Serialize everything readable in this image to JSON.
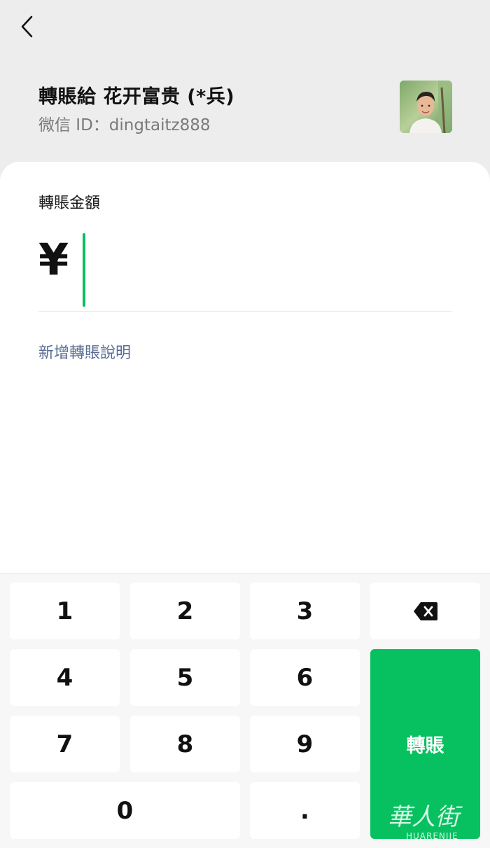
{
  "header": {
    "title": "轉賬給 花开富贵 (*兵)",
    "wechat_id": "微信 ID：dingtaitz888"
  },
  "amount": {
    "label": "轉賬金額",
    "currency": "¥",
    "value": ""
  },
  "note": {
    "link_label": "新增轉賬說明"
  },
  "keypad": {
    "keys": {
      "k1": "1",
      "k2": "2",
      "k3": "3",
      "k4": "4",
      "k5": "5",
      "k6": "6",
      "k7": "7",
      "k8": "8",
      "k9": "9",
      "k0": "0",
      "dot": "."
    },
    "confirm_label": "轉賬",
    "backspace_icon": "backspace-icon"
  },
  "watermark": {
    "text": "華人街",
    "subtext": "HUARENJIE"
  },
  "colors": {
    "accent_green": "#07c160",
    "link_blue": "#576b95"
  }
}
